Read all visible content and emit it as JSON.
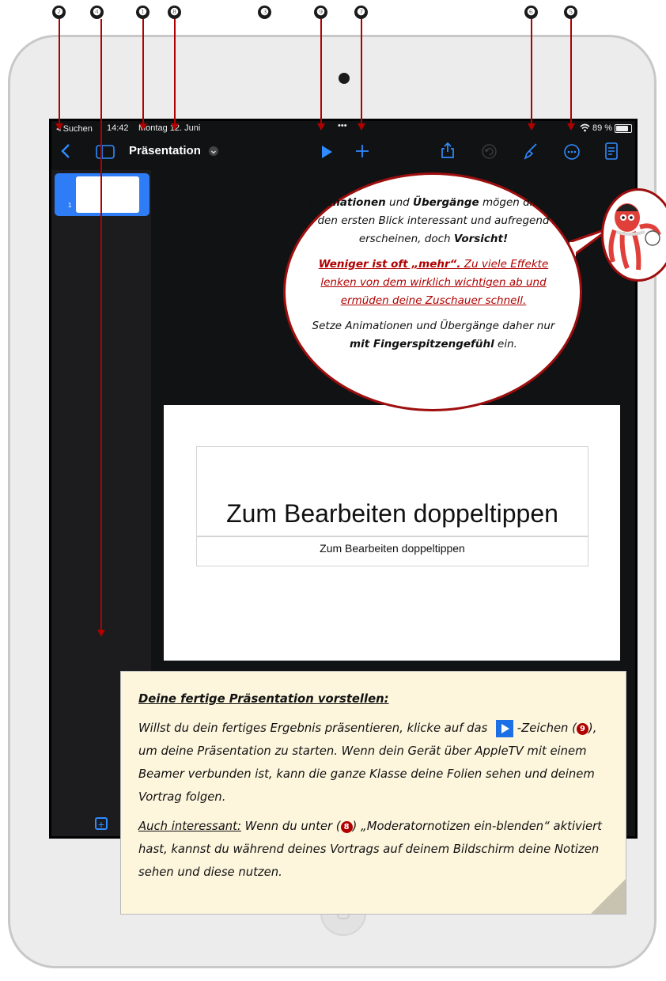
{
  "markers": [
    "❷",
    "❹",
    "❶",
    "❽",
    "❸",
    "❾",
    "❼",
    "❻",
    "❺"
  ],
  "status": {
    "back_label": "◂ Suchen",
    "time": "14:42",
    "date": "Montag 12. Juni",
    "dots": "•••",
    "battery": "89 %"
  },
  "toolbar": {
    "title": "Präsentation",
    "play_icon": "play-icon",
    "add_icon": "plus-icon"
  },
  "sidebar": {
    "slide_number": "1"
  },
  "slide": {
    "title": "Zum Bearbeiten doppeltippen",
    "subtitle": "Zum Bearbeiten doppeltippen"
  },
  "bubble": {
    "p1_bold_a": "Animationen",
    "p1_a": " und ",
    "p1_bold_b": "Übergänge",
    "p1_b": " mögen dir auf den ersten Blick interessant und aufregend erscheinen, doch ",
    "p1_bold_c": "Vorsicht!",
    "p2_bold": "Weniger ist oft „mehr“.",
    "p2_rest": " Zu viele Effekte lenken von dem wirklich wichtigen ab und ermüden deine Zuschauer schnell.",
    "p3_a": "Setze Animationen und Übergänge daher nur ",
    "p3_bold": "mit Fingerspitzengefühl",
    "p3_b": " ein."
  },
  "note": {
    "heading": "Deine fertige Präsentation vorstellen:",
    "p1_a": "Willst du dein fertiges Ergebnis präsentieren, klicke auf das ",
    "p1_b": " -Zeichen (",
    "p1_marker": "9",
    "p1_c": "), um deine Präsentation zu starten. Wenn dein Gerät über AppleTV mit einem Beamer verbunden ist, kann die ganze Klasse deine Folien sehen und deinem Vortrag folgen.",
    "p2_label": "Auch interessant:",
    "p2_a": " Wenn du unter (",
    "p2_marker": "8",
    "p2_b": ") „Moderatornotizen ein-blenden“ aktiviert hast, kannst du während deines Vortrags auf deinem Bildschirm deine Notizen sehen und diese nutzen."
  },
  "colors": {
    "accent": "#2f8bff",
    "pointer": "#b00000",
    "note_bg": "#fdf6dd"
  }
}
